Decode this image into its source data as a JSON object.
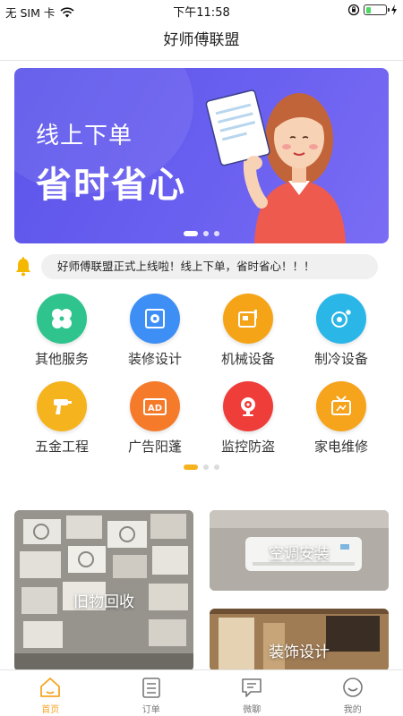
{
  "status_bar": {
    "carrier": "无 SIM 卡",
    "time": "下午11:58"
  },
  "nav": {
    "title": "好师傅联盟"
  },
  "banner": {
    "line1": "线上下单",
    "line2": "省时省心",
    "slide_count": 3,
    "active_slide": 1
  },
  "notice": {
    "text": "好师傅联盟正式上线啦！线上下单，省时省心！！！",
    "icon": "bell-icon"
  },
  "services": [
    {
      "label": "其他服务",
      "icon": "clover-icon",
      "color": "#2fc48d"
    },
    {
      "label": "装修设计",
      "icon": "gear-frame-icon",
      "color": "#3d8ef5"
    },
    {
      "label": "机械设备",
      "icon": "machine-icon",
      "color": "#f5a418"
    },
    {
      "label": "制冷设备",
      "icon": "snowflake-fan-icon",
      "color": "#2bb6e8"
    },
    {
      "label": "五金工程",
      "icon": "drill-icon",
      "color": "#f5b31d"
    },
    {
      "label": "广告阳蓬",
      "icon": "ad-icon",
      "color": "#f57b2b"
    },
    {
      "label": "监控防盗",
      "icon": "camera-icon",
      "color": "#ef3d3a"
    },
    {
      "label": "家电维修",
      "icon": "tv-icon",
      "color": "#f5a41c"
    }
  ],
  "service_pages": {
    "count": 3,
    "active": 1
  },
  "cards": {
    "recycle": "旧物回收",
    "ac_install": "空调安装",
    "decoration": "装饰设计"
  },
  "tabs": [
    {
      "label": "首页",
      "icon": "home-icon",
      "active": true
    },
    {
      "label": "订单",
      "icon": "order-list-icon",
      "active": false
    },
    {
      "label": "微聊",
      "icon": "chat-icon",
      "active": false
    },
    {
      "label": "我的",
      "icon": "profile-icon",
      "active": false
    }
  ],
  "colors": {
    "accent": "#f5a623",
    "banner": "#5b54ea"
  }
}
